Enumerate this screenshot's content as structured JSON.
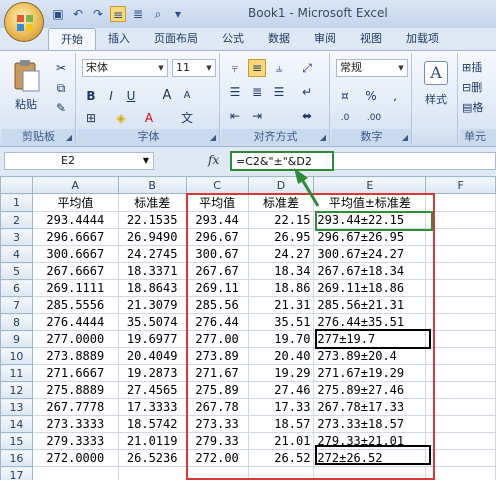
{
  "window": {
    "title": "Book1 - Microsoft Excel"
  },
  "qat": {
    "items": [
      "save-icon",
      "undo-icon",
      "redo-icon",
      "align-icon",
      "align-center-icon",
      "print-preview-icon"
    ]
  },
  "tabs": [
    "开始",
    "插入",
    "页面布局",
    "公式",
    "数据",
    "审阅",
    "视图",
    "加载项"
  ],
  "ribbon": {
    "clipboard": {
      "label": "剪贴板",
      "paste": "粘贴"
    },
    "font": {
      "label": "字体",
      "name": "宋体",
      "size": "11",
      "bold": "B",
      "italic": "I",
      "underline": "U",
      "grow": "A",
      "shrink": "A",
      "wen": "文"
    },
    "alignment": {
      "label": "对齐方式"
    },
    "number": {
      "label": "数字",
      "format": "常规",
      "percent": "%",
      "comma": ",",
      "inc": ".0",
      "dec": ".00"
    },
    "styles": {
      "label": "样式",
      "icon": "A"
    },
    "cells": {
      "label": "单元",
      "insert": "插",
      "delete": "删",
      "format": "格"
    }
  },
  "formula_bar": {
    "name_box": "E2",
    "fx": "fx",
    "formula": "=C2&\"±\"&D2"
  },
  "columns": [
    "A",
    "B",
    "C",
    "D",
    "E",
    "F"
  ],
  "rows": [
    {
      "n": "1",
      "a": "平均值",
      "b": "标准差",
      "c": "平均值",
      "d": "标准差",
      "e": "平均值±标准差"
    },
    {
      "n": "2",
      "a": "293.4444",
      "b": "22.1535",
      "c": "293.44",
      "d": "22.15",
      "e": "293.44±22.15"
    },
    {
      "n": "3",
      "a": "296.6667",
      "b": "26.9490",
      "c": "296.67",
      "d": "26.95",
      "e": "296.67±26.95"
    },
    {
      "n": "4",
      "a": "300.6667",
      "b": "24.2745",
      "c": "300.67",
      "d": "24.27",
      "e": "300.67±24.27"
    },
    {
      "n": "5",
      "a": "267.6667",
      "b": "18.3371",
      "c": "267.67",
      "d": "18.34",
      "e": "267.67±18.34"
    },
    {
      "n": "6",
      "a": "269.1111",
      "b": "18.8643",
      "c": "269.11",
      "d": "18.86",
      "e": "269.11±18.86"
    },
    {
      "n": "7",
      "a": "285.5556",
      "b": "21.3079",
      "c": "285.56",
      "d": "21.31",
      "e": "285.56±21.31"
    },
    {
      "n": "8",
      "a": "276.4444",
      "b": "35.5074",
      "c": "276.44",
      "d": "35.51",
      "e": "276.44±35.51"
    },
    {
      "n": "9",
      "a": "277.0000",
      "b": "19.6977",
      "c": "277.00",
      "d": "19.70",
      "e": "277±19.7"
    },
    {
      "n": "10",
      "a": "273.8889",
      "b": "20.4049",
      "c": "273.89",
      "d": "20.40",
      "e": "273.89±20.4"
    },
    {
      "n": "11",
      "a": "271.6667",
      "b": "19.2873",
      "c": "271.67",
      "d": "19.29",
      "e": "271.67±19.29"
    },
    {
      "n": "12",
      "a": "275.8889",
      "b": "27.4565",
      "c": "275.89",
      "d": "27.46",
      "e": "275.89±27.46"
    },
    {
      "n": "13",
      "a": "267.7778",
      "b": "17.3333",
      "c": "267.78",
      "d": "17.33",
      "e": "267.78±17.33"
    },
    {
      "n": "14",
      "a": "273.3333",
      "b": "18.5742",
      "c": "273.33",
      "d": "18.57",
      "e": "273.33±18.57"
    },
    {
      "n": "15",
      "a": "279.3333",
      "b": "21.0119",
      "c": "279.33",
      "d": "21.01",
      "e": "279.33±21.01"
    },
    {
      "n": "16",
      "a": "272.0000",
      "b": "26.5236",
      "c": "272.00",
      "d": "26.52",
      "e": "272±26.52"
    },
    {
      "n": "17",
      "a": "",
      "b": "",
      "c": "",
      "d": "",
      "e": ""
    }
  ],
  "colors": {
    "highlight_red": "#d93636",
    "highlight_green": "#2e8b3a",
    "highlight_black": "#000000"
  }
}
